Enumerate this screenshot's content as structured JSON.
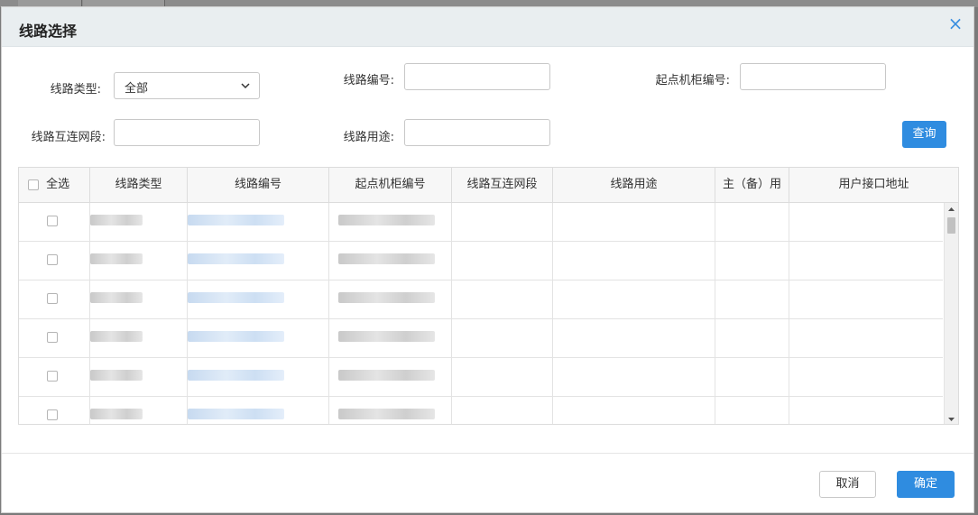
{
  "dialog": {
    "title": "线路选择",
    "close_glyph": "×"
  },
  "filters": {
    "line_type_label": "线路类型:",
    "line_type_value": "全部",
    "line_no_label": "线路编号:",
    "start_cabinet_label": "起点机柜编号:",
    "interconnect_label": "线路互连网段:",
    "usage_label": "线路用途:",
    "query_label": "查询"
  },
  "table": {
    "select_all_label": "全选",
    "columns": [
      "线路类型",
      "线路编号",
      "起点机柜编号",
      "线路互连网段",
      "线路用途",
      "主（备）用",
      "用户接口地址"
    ]
  },
  "footer": {
    "cancel_label": "取消",
    "ok_label": "确定"
  },
  "colors": {
    "accent": "#2f8ce0",
    "header_bg": "#e9eef0"
  },
  "icons": {
    "close": "close-icon",
    "select": "chevron-down-icon",
    "scroll_up": "scroll-up-icon",
    "scroll_down": "scroll-down-icon"
  }
}
